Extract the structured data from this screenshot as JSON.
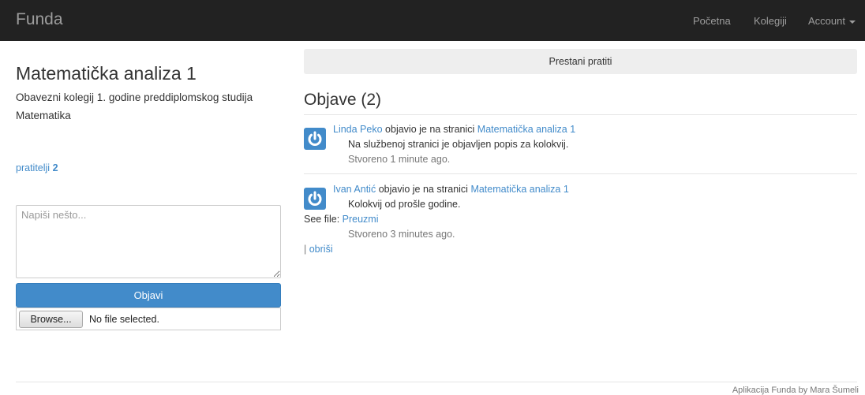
{
  "navbar": {
    "brand": "Funda",
    "links": [
      "Početna",
      "Kolegiji"
    ],
    "account": "Account"
  },
  "course": {
    "title": "Matematička analiza 1",
    "description": "Obavezni kolegij 1. godine preddiplomskog studija Matematika",
    "followers_label": "pratitelji",
    "followers_count": "2"
  },
  "composer": {
    "placeholder": "Napiši nešto...",
    "publish_label": "Objavi",
    "browse_label": "Browse...",
    "file_status": "No file selected."
  },
  "feed": {
    "unfollow_label": "Prestani pratiti",
    "heading": "Objave (2)",
    "posts": [
      {
        "author": "Linda Peko",
        "action": "objavio je na stranici",
        "page": "Matematička analiza 1",
        "text": "Na službenoj stranici je objavljen popis za kolokvij.",
        "time": "Stvoreno 1 minute ago."
      },
      {
        "author": "Ivan Antić",
        "action": "objavio je na stranici",
        "page": "Matematička analiza 1",
        "text": "Kolokvij od prošle godine.",
        "see_file_label": "See file:",
        "file_link": "Preuzmi",
        "time": "Stvoreno 3 minutes ago.",
        "delete_separator": "|",
        "delete_label": "obriši"
      }
    ]
  },
  "footer": {
    "credit": "Aplikacija Funda by Mara Šumeli"
  },
  "colors": {
    "navbar_bg": "#222222",
    "primary": "#428bca",
    "muted": "#777777"
  }
}
